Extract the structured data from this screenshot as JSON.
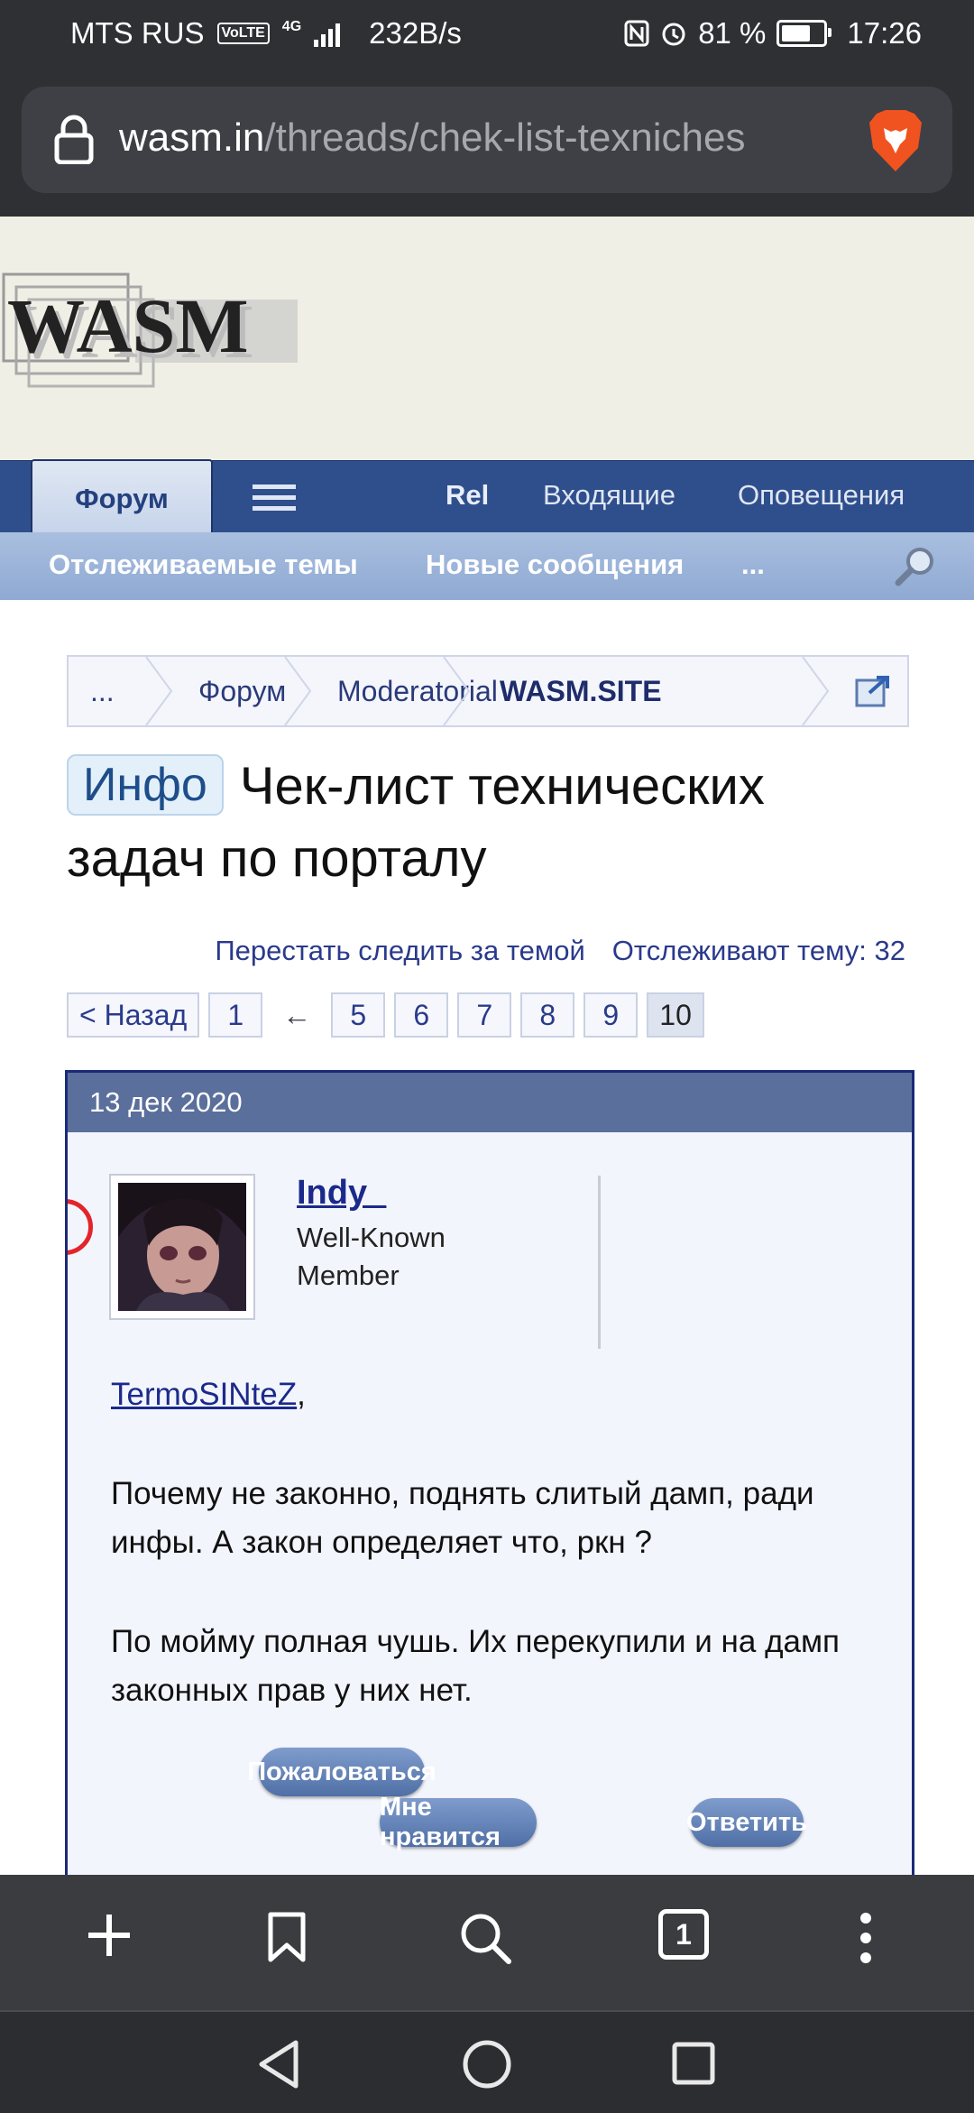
{
  "status_bar": {
    "carrier": "MTS RUS",
    "volte": "VoLTE",
    "network": "4G",
    "speed": "232B/s",
    "battery_text": "81 %",
    "battery_level": 0.81,
    "time": "17:26"
  },
  "url_bar": {
    "domain": "wasm.in",
    "path": "/threads/chek-list-texniches"
  },
  "site": {
    "logo_text": "WASM"
  },
  "nav": {
    "forum_tab": "Форум",
    "rel": "Rel",
    "inbox": "Входящие",
    "alerts": "Оповещения"
  },
  "subnav": {
    "watched": "Отслеживаемые темы",
    "new_posts": "Новые сообщения",
    "more": "..."
  },
  "breadcrumb": [
    {
      "label": "..."
    },
    {
      "label": "Форум"
    },
    {
      "label": "Moderatorial"
    },
    {
      "label": "WASM.SITE"
    }
  ],
  "thread": {
    "prefix": "Инфо",
    "title": "Чек-лист технических задач по порталу",
    "unwatch": "Перестать следить за темой",
    "watchers": "Отслеживают тему: 32"
  },
  "pagination": {
    "prev": "< Назад",
    "first": "1",
    "gap": "←",
    "pages": [
      "5",
      "6",
      "7",
      "8",
      "9",
      "10"
    ],
    "current": "10"
  },
  "post": {
    "date": "13 дек 2020",
    "username": "Indy_",
    "user_title": "Well-Known Member",
    "mention": "TermoSINteZ",
    "mention_suffix": ",",
    "paragraph1": "Почему не законно, поднять слитый дамп, ради инфы. А закон определяет что, ркн ?",
    "paragraph2": "По мойму полная чушь. Их перекупили и на дамп законных прав у них нет.",
    "report": "Пожаловаться",
    "like": "Мне нравится",
    "reply": "Ответить"
  },
  "toolbar": {
    "tabs_count": "1"
  },
  "colors": {
    "nav_bar": "#2f4f8c",
    "subnav": "#9fb6db",
    "post_header": "#5a6f9b",
    "link": "#1b2a8a",
    "button": "#5e7db2"
  },
  "icons": [
    "lock-icon",
    "brave-lion-icon",
    "hamburger-icon",
    "search-magnifier-icon",
    "external-link-icon",
    "plus-icon",
    "bookmark-icon",
    "search-icon",
    "tabs-icon",
    "more-icon",
    "back-icon",
    "home-icon",
    "recents-icon"
  ]
}
